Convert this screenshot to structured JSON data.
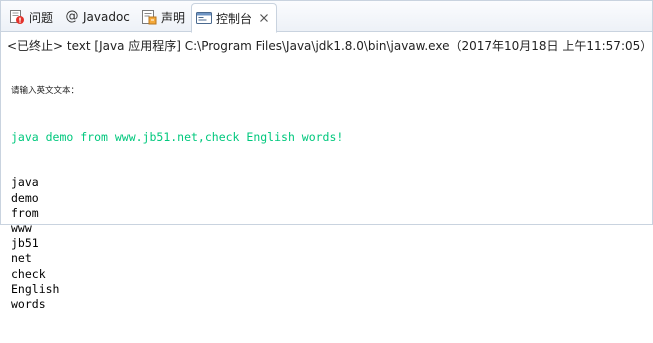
{
  "tabs": [
    {
      "label": "问题",
      "icon": "problems-icon"
    },
    {
      "label": "Javadoc",
      "icon": "at-icon",
      "icon_glyph": "@"
    },
    {
      "label": "声明",
      "icon": "declaration-icon"
    },
    {
      "label": "控制台",
      "icon": "console-icon",
      "active": true,
      "close_icon": "close-icon",
      "close_glyph": "✕"
    }
  ],
  "status_line": "<已终止> text [Java 应用程序] C:\\Program Files\\Java\\jdk1.8.0\\bin\\javaw.exe（2017年10月18日 上午11:57:05）",
  "console": {
    "prompt": "请输入英文文本：",
    "input": "java demo from www.jb51.net,check English words!",
    "output_lines": [
      "java",
      "demo",
      "from",
      "www",
      "jb51",
      "net",
      "check",
      "English",
      "words"
    ]
  },
  "colors": {
    "input_text": "#00c87d",
    "active_tab_bg": "#ffffff",
    "tabbar_bg": "#edf1f7",
    "border": "#c9d3df"
  }
}
